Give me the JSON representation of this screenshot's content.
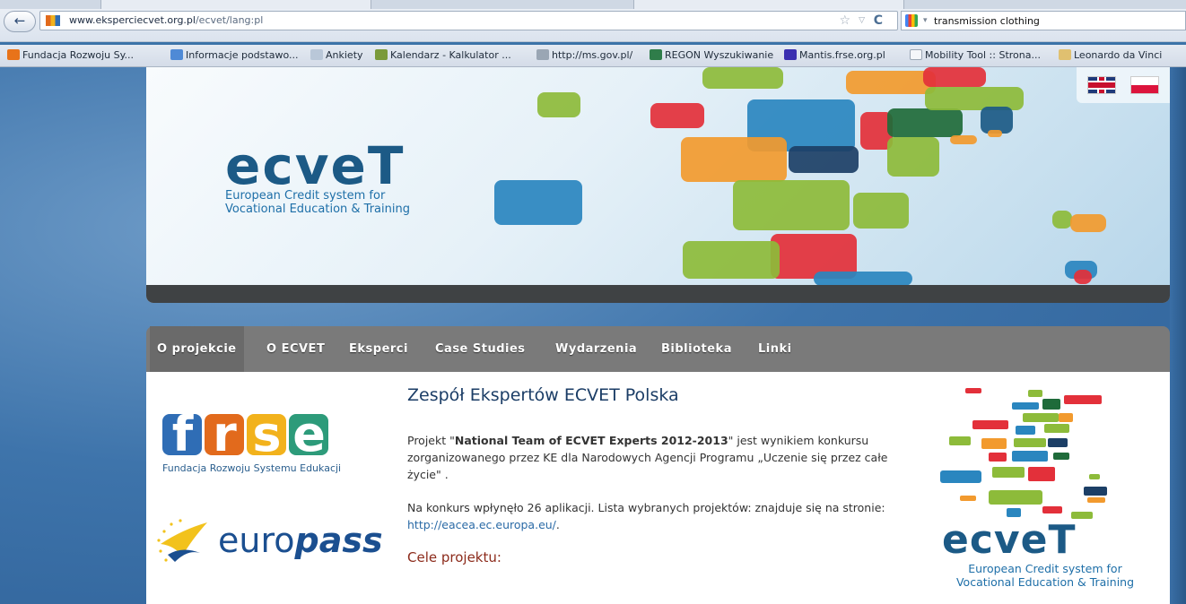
{
  "browser": {
    "url_domain": "www.eksperciecvet.org.pl",
    "url_path": "/ecvet/lang:pl",
    "search_value": "transmission clothing",
    "back_glyph": "←",
    "star_glyph": "☆",
    "drop_glyph": "▽",
    "reload_glyph": "C",
    "search_drop_glyph": "▾"
  },
  "bookmarks": [
    {
      "label": "Fundacja Rozwoju Sy...",
      "icon": "frse-icon",
      "color": "#e8731a"
    },
    {
      "label": "Informacje podstawo...",
      "icon": "chart-icon",
      "color": "#4f8ad6"
    },
    {
      "label": "Ankiety",
      "icon": "doc-icon",
      "color": "#b9c7d8"
    },
    {
      "label": "Kalendarz - Kalkulator ...",
      "icon": "calendar-icon",
      "color": "#7a9a3a"
    },
    {
      "label": "http://ms.gov.pl/",
      "icon": "eagle-icon",
      "color": "#9aa6b4"
    },
    {
      "label": "REGON Wyszukiwanie",
      "icon": "gus-icon",
      "color": "#2f7d4a"
    },
    {
      "label": "Mantis.frse.org.pl",
      "icon": "mantis-icon",
      "color": "#3a2fb0"
    },
    {
      "label": "Mobility Tool :: Strona...",
      "icon": "blank-icon",
      "color": "#f4f6f9"
    },
    {
      "label": "Leonardo da Vinci",
      "icon": "leonardo-icon",
      "color": "#e0c070"
    }
  ],
  "banner": {
    "logo_word": "ecveT",
    "logo_sub_1": "European Credit system for",
    "logo_sub_2": "Vocational Education & Training"
  },
  "nav": [
    {
      "label": "O projekcie"
    },
    {
      "label": "O ECVET"
    },
    {
      "label": "Eksperci"
    },
    {
      "label": "Case Studies"
    },
    {
      "label": "Wydarzenia"
    },
    {
      "label": "Biblioteka"
    },
    {
      "label": "Linki"
    }
  ],
  "left": {
    "frse_letters": [
      "f",
      "r",
      "s",
      "e"
    ],
    "frse_colors": [
      "#2f6db5",
      "#e26a1c",
      "#f2b21c",
      "#2d9b7a"
    ],
    "frse_caption": "Fundacja Rozwoju Systemu Edukacji",
    "europass_pre": "euro",
    "europass_bold": "pass"
  },
  "main": {
    "title": "Zespół Ekspertów ECVET Polska",
    "p1_a": "Projekt \"",
    "p1_bold": "National Team of ECVET Experts 2012-2013",
    "p1_b": "\" jest wynikiem konkursu zorganizowanego przez KE dla Narodowych Agencji Programu „Uczenie się przez całe życie\" .",
    "p2_a": "Na konkurs wpłynęło 26 aplikacji. Lista wybranych projektów: znajduje się na stronie: ",
    "p2_link": "http://eacea.ec.europa.eu/",
    "p2_b": ".",
    "subtitle": "Cele projektu:"
  },
  "right": {
    "word": "ecveT",
    "sub_1": "European Credit system for",
    "sub_2": "Vocational Education & Training"
  }
}
